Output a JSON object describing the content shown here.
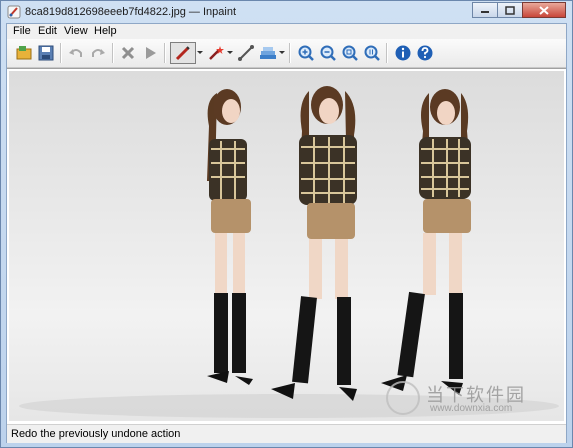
{
  "window": {
    "title": "8ca819d812698eeeb7fd4822.jpg — Inpaint"
  },
  "menu": {
    "items": [
      {
        "label": "File"
      },
      {
        "label": "Edit"
      },
      {
        "label": "View"
      },
      {
        "label": "Help"
      }
    ]
  },
  "toolbar": {
    "buttons": [
      {
        "icon": "open-icon"
      },
      {
        "icon": "save-icon"
      },
      {
        "icon": "undo-icon"
      },
      {
        "icon": "redo-icon"
      },
      {
        "icon": "erase-icon"
      },
      {
        "icon": "run-icon"
      },
      {
        "icon": "marker-icon"
      },
      {
        "icon": "magic-wand-icon"
      },
      {
        "icon": "line-icon"
      },
      {
        "icon": "layers-icon"
      },
      {
        "icon": "zoom-in-icon"
      },
      {
        "icon": "zoom-out-icon"
      },
      {
        "icon": "zoom-fit-icon"
      },
      {
        "icon": "zoom-actual-icon"
      },
      {
        "icon": "info-icon"
      },
      {
        "icon": "help-icon"
      }
    ]
  },
  "status": {
    "text": "Redo the previously undone action"
  },
  "watermark": {
    "text": "当下软件园",
    "url": "www.downxia.com"
  },
  "colors": {
    "accent": "#1f5fb5",
    "close": "#c8463a"
  }
}
